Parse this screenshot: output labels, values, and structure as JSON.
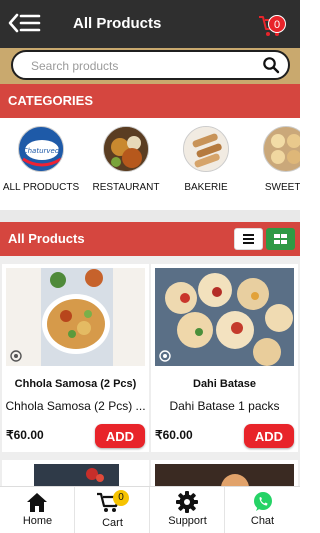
{
  "header": {
    "title": "All Products",
    "cart_count": "0"
  },
  "search": {
    "placeholder": "Search products"
  },
  "categories": {
    "heading": "CATEGORIES",
    "items": [
      {
        "label": "ALL PRODUCTS",
        "logo_text": "Chaturvedi"
      },
      {
        "label": "RESTAURANT"
      },
      {
        "label": "BAKERIE"
      },
      {
        "label": "SWEETS"
      }
    ]
  },
  "products_section": {
    "heading": "All Products",
    "view_list_icon": "list-icon",
    "view_grid_icon": "grid-icon",
    "grid_active_color": "#2f9a44"
  },
  "products": [
    {
      "name": "Chhola Samosa (2 Pcs)",
      "desc": "Chhola Samosa (2 Pcs) ...",
      "price": "₹60.00",
      "add_label": "ADD"
    },
    {
      "name": "Dahi Batase",
      "desc": "Dahi Batase 1 packs",
      "price": "₹60.00",
      "add_label": "ADD"
    }
  ],
  "bottom_nav": {
    "home": "Home",
    "cart": "Cart",
    "cart_count": "0",
    "support": "Support",
    "chat": "Chat"
  },
  "colors": {
    "accent_red": "#d5463f",
    "add_button": "#e8242a",
    "topbar": "#2f2f2f",
    "search_band": "#c9a96e"
  }
}
